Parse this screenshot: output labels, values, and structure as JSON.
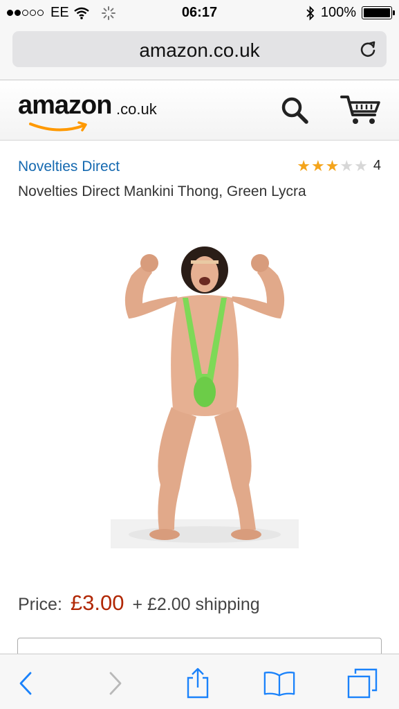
{
  "status_bar": {
    "carrier": "EE",
    "time": "06:17",
    "battery": "100%",
    "battery_level": 1.0,
    "signal_bars_filled": 2,
    "signal_bars_total": 5
  },
  "browser": {
    "url": "amazon.co.uk"
  },
  "header": {
    "logo_main": "amazon",
    "logo_tld": ".co.uk",
    "icons": [
      "search-icon",
      "cart-icon"
    ]
  },
  "product": {
    "brand": "Novelties Direct",
    "rating_stars": 3,
    "rating_max": 5,
    "rating_count": "4",
    "title": "Novelties Direct Mankini Thong, Green Lycra",
    "price_label": "Price:",
    "price": "£3.00",
    "shipping": "+ £2.00 shipping"
  },
  "toolbar": {
    "icons": [
      "back-icon",
      "forward-icon",
      "share-icon",
      "bookmarks-icon",
      "tabs-icon"
    ]
  },
  "colors": {
    "link": "#1569b0",
    "price": "#b12704",
    "star": "#f4a41b",
    "ios_blue": "#1a82fb",
    "amazon_orange": "#f90"
  }
}
